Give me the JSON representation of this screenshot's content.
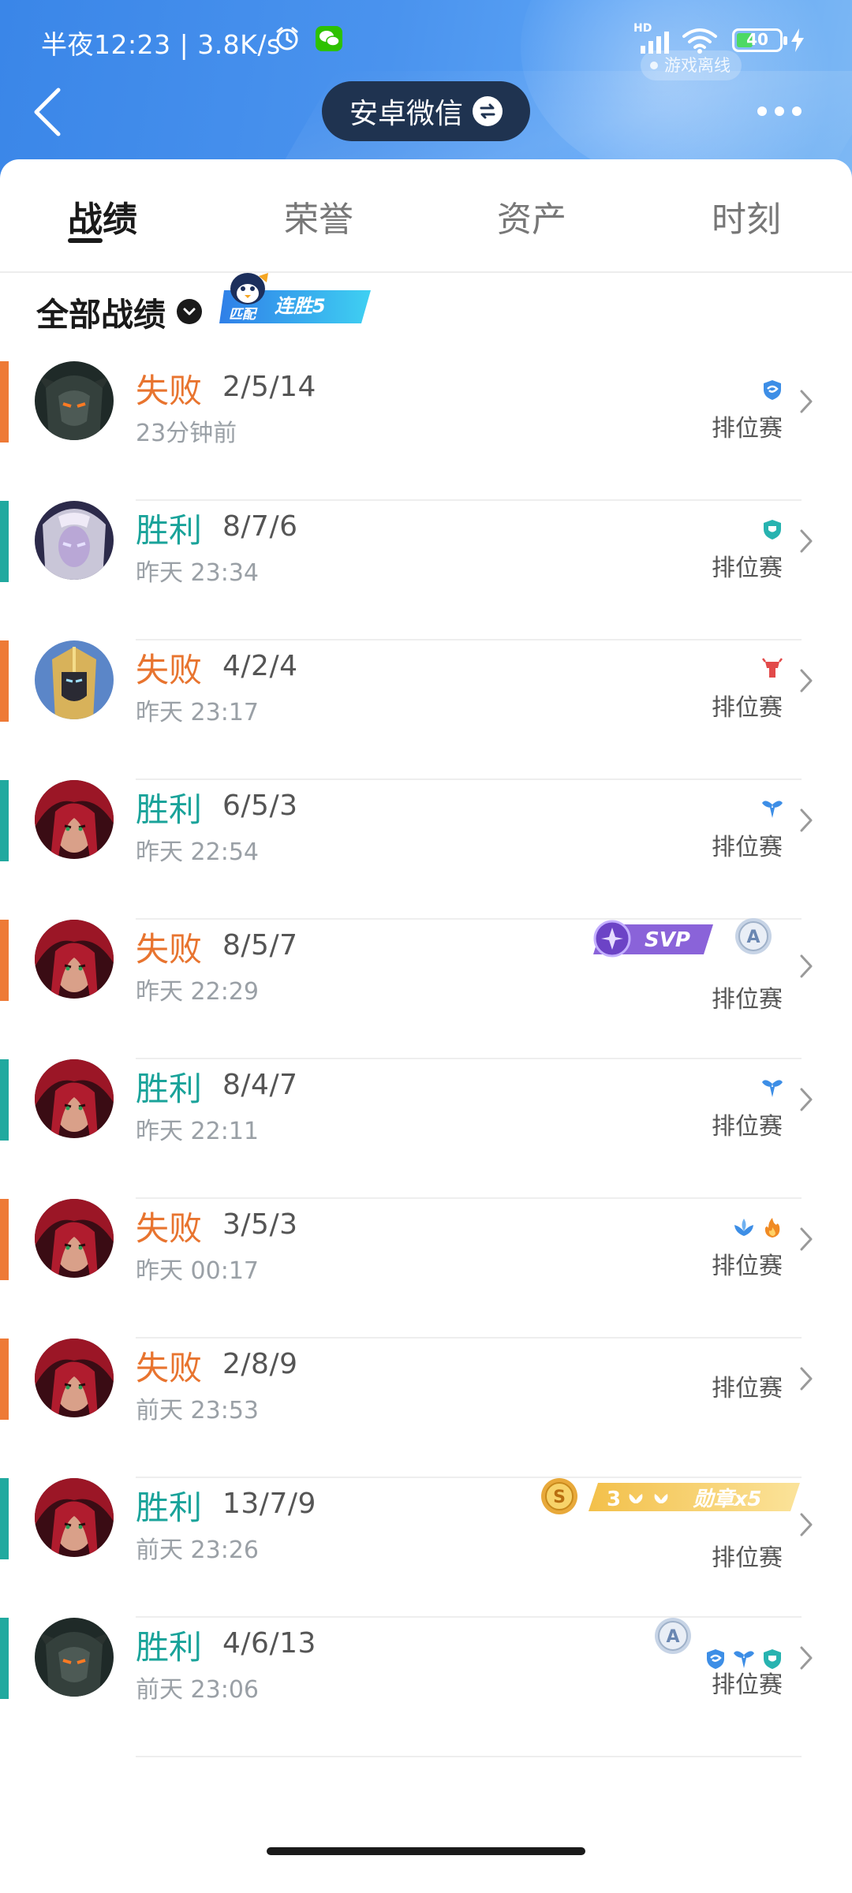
{
  "status": {
    "time": "半夜12:23 | 3.8K/s",
    "hd": "HD",
    "battery": "40",
    "offline": "游戏离线"
  },
  "header": {
    "account": "安卓微信"
  },
  "tabs": [
    "战绩",
    "荣誉",
    "资产",
    "时刻"
  ],
  "filter": {
    "label": "全部战绩",
    "streak_mode": "匹配",
    "streak_text": "连胜5"
  },
  "colors": {
    "win": "#1aa39a",
    "loss": "#e8742f",
    "win_bar": "#21a99f",
    "loss_bar": "#ee7a36",
    "header_blue": "#3f8bea",
    "pill_dark": "#1f3350"
  },
  "matches": [
    {
      "result": "失败",
      "kda": "2/5/14",
      "time": "23分钟前",
      "mode": "排位赛",
      "outcome": "loss",
      "hero": "dark-armor",
      "icons": [
        "shield-swirl-icon"
      ]
    },
    {
      "result": "胜利",
      "kda": "8/7/6",
      "time": "昨天 23:34",
      "mode": "排位赛",
      "outcome": "win",
      "hero": "pale-mage",
      "icons": [
        "shield-badge-icon"
      ]
    },
    {
      "result": "失败",
      "kda": "4/2/4",
      "time": "昨天 23:17",
      "mode": "排位赛",
      "outcome": "loss",
      "hero": "gold-knight",
      "icons": [
        "red-tower-icon"
      ]
    },
    {
      "result": "胜利",
      "kda": "6/5/3",
      "time": "昨天 22:54",
      "mode": "排位赛",
      "outcome": "win",
      "hero": "red-hair",
      "icons": [
        "wings-icon"
      ]
    },
    {
      "result": "失败",
      "kda": "8/5/7",
      "time": "昨天 22:29",
      "mode": "排位赛",
      "outcome": "loss",
      "hero": "red-hair",
      "icons": [],
      "svp": "SVP",
      "medal": "A"
    },
    {
      "result": "胜利",
      "kda": "8/4/7",
      "time": "昨天 22:11",
      "mode": "排位赛",
      "outcome": "win",
      "hero": "red-hair",
      "icons": [
        "wings-icon"
      ]
    },
    {
      "result": "失败",
      "kda": "3/5/3",
      "time": "昨天 00:17",
      "mode": "排位赛",
      "outcome": "loss",
      "hero": "red-hair",
      "icons": [
        "lotus-icon",
        "flame-icon"
      ]
    },
    {
      "result": "失败",
      "kda": "2/8/9",
      "time": "前天 23:53",
      "mode": "排位赛",
      "outcome": "loss",
      "hero": "red-hair",
      "icons": []
    },
    {
      "result": "胜利",
      "kda": "13/7/9",
      "time": "前天 23:26",
      "mode": "排位赛",
      "outcome": "win",
      "hero": "red-hair",
      "icons": [],
      "medal": "S",
      "honor": {
        "count": "3",
        "text": "勋章x5"
      }
    },
    {
      "result": "胜利",
      "kda": "4/6/13",
      "time": "前天 23:06",
      "mode": "排位赛",
      "outcome": "win",
      "hero": "dark-armor",
      "icons": [
        "shield-swirl-icon",
        "wings-icon",
        "shield-badge-icon"
      ],
      "medal": "A"
    }
  ]
}
